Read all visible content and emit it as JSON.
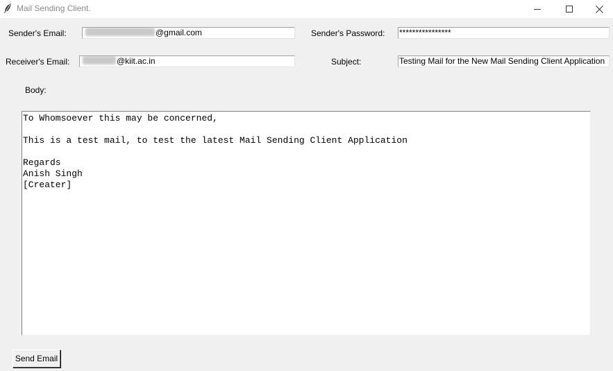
{
  "window": {
    "title": "Mail Sending Client.",
    "icon": "feather-icon",
    "controls": [
      "minimize-icon",
      "maximize-icon",
      "close-icon"
    ]
  },
  "form": {
    "sender_email_label": "Sender's Email:",
    "sender_email_value": "@gmail.com",
    "sender_password_label": "Sender's Password:",
    "sender_password_value": "****************",
    "receiver_email_label": "Receiver's Email:",
    "receiver_email_value": "@kiit.ac.in",
    "subject_label": "Subject:",
    "subject_value": "Testing Mail for the New Mail Sending Client Application",
    "body_label": "Body:",
    "body_value": "To Whomsoever this may be concerned,\n\nThis is a test mail, to test the latest Mail Sending Client Application\n\nRegards\nAnish Singh\n[Creater]"
  },
  "actions": {
    "send_label": "Send Email"
  }
}
